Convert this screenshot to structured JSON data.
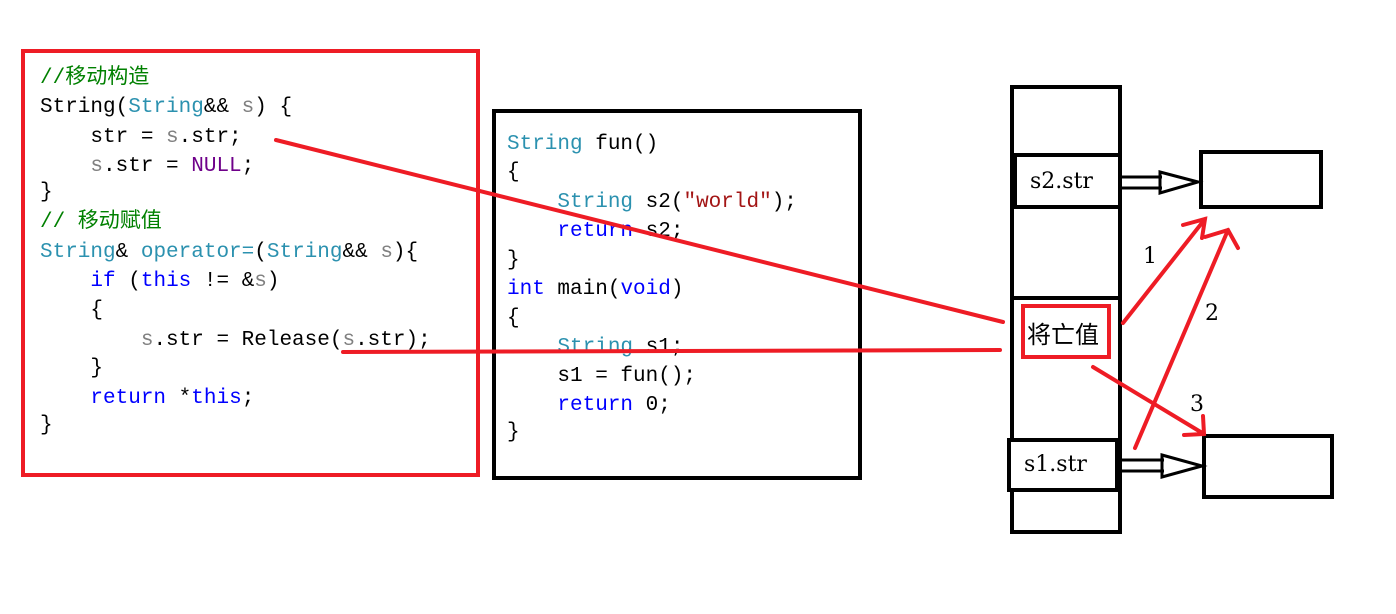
{
  "colors": {
    "plain": "#000000",
    "type": "#2b91af",
    "param": "#808080",
    "macro": "#6f008a",
    "keyword": "#0000ff",
    "comment": "#008000",
    "string": "#a31515",
    "annotation": "#ee1c25"
  },
  "left_code": [
    [
      [
        "//移动构造",
        "comment"
      ]
    ],
    [
      [
        "String(",
        "plain"
      ],
      [
        "String",
        "type"
      ],
      [
        "&& ",
        "plain"
      ],
      [
        "s",
        "param"
      ],
      [
        ") {",
        "plain"
      ]
    ],
    [
      [
        "    str = ",
        "plain"
      ],
      [
        "s",
        "param"
      ],
      [
        ".str;",
        "plain"
      ]
    ],
    [
      [
        "    ",
        "plain"
      ],
      [
        "s",
        "param"
      ],
      [
        ".str = ",
        "plain"
      ],
      [
        "NULL",
        "macro"
      ],
      [
        ";",
        "plain"
      ]
    ],
    [
      [
        "}",
        "plain"
      ]
    ],
    [
      [
        "// 移动赋值",
        "comment"
      ]
    ],
    [
      [
        "String",
        "type"
      ],
      [
        "& ",
        "plain"
      ],
      [
        "operator=",
        "type"
      ],
      [
        "(",
        "plain"
      ],
      [
        "String",
        "type"
      ],
      [
        "&& ",
        "plain"
      ],
      [
        "s",
        "param"
      ],
      [
        "){",
        "plain"
      ]
    ],
    [
      [
        "    ",
        "plain"
      ],
      [
        "if",
        "keyword"
      ],
      [
        " (",
        "plain"
      ],
      [
        "this",
        "keyword"
      ],
      [
        " != &",
        "plain"
      ],
      [
        "s",
        "param"
      ],
      [
        ")",
        "plain"
      ]
    ],
    [
      [
        "    {",
        "plain"
      ]
    ],
    [
      [
        "        ",
        "plain"
      ],
      [
        "s",
        "param"
      ],
      [
        ".str = Release(",
        "plain"
      ],
      [
        "s",
        "param"
      ],
      [
        ".str);",
        "plain"
      ]
    ],
    [
      [
        "    }",
        "plain"
      ]
    ],
    [
      [
        "    ",
        "plain"
      ],
      [
        "return",
        "keyword"
      ],
      [
        " *",
        "plain"
      ],
      [
        "this",
        "keyword"
      ],
      [
        ";",
        "plain"
      ]
    ],
    [
      [
        "}",
        "plain"
      ]
    ]
  ],
  "middle_code": [
    [
      [
        "String",
        "type"
      ],
      [
        " fun()",
        "plain"
      ]
    ],
    [
      [
        "{",
        "plain"
      ]
    ],
    [
      [
        "    ",
        "plain"
      ],
      [
        "String",
        "type"
      ],
      [
        " s2(",
        "plain"
      ],
      [
        "\"world\"",
        "string"
      ],
      [
        ");",
        "plain"
      ]
    ],
    [
      [
        "    ",
        "plain"
      ],
      [
        "return",
        "keyword"
      ],
      [
        " s2;",
        "plain"
      ]
    ],
    [
      [
        "}",
        "plain"
      ]
    ],
    [
      [
        "int",
        "keyword"
      ],
      [
        " main(",
        "plain"
      ],
      [
        "void",
        "keyword"
      ],
      [
        ")",
        "plain"
      ]
    ],
    [
      [
        "{",
        "plain"
      ]
    ],
    [
      [
        "    ",
        "plain"
      ],
      [
        "String",
        "type"
      ],
      [
        " s1;",
        "plain"
      ]
    ],
    [
      [
        "    s1 = fun();",
        "plain"
      ]
    ],
    [
      [
        "    ",
        "plain"
      ],
      [
        "return",
        "keyword"
      ],
      [
        " 0;",
        "plain"
      ]
    ],
    [
      [
        "}",
        "plain"
      ]
    ]
  ],
  "stack": {
    "s2_label": "s2.str",
    "s1_label": "s1.str",
    "xvalue_label": "将亡值"
  },
  "arrow_labels": [
    "1",
    "2",
    "3"
  ]
}
